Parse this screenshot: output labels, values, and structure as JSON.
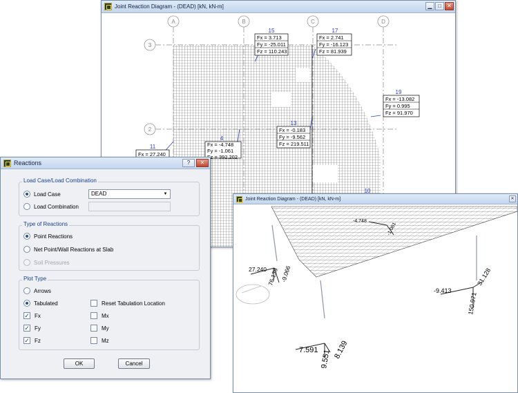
{
  "plan_window": {
    "title": "Joint Reaction Diagram   - (DEAD)  [kN,  kN-m]",
    "grid_columns": [
      "A",
      "B",
      "C",
      "D"
    ],
    "grid_rows": [
      "3",
      "2"
    ],
    "joints": [
      {
        "id": "15",
        "fx": "Fx = 3.713",
        "fy": "Fy = -25.011",
        "fz": "Fz = 110.243"
      },
      {
        "id": "17",
        "fx": "Fx = 2.741",
        "fy": "Fy = -16.123",
        "fz": "Fz = 81.939"
      },
      {
        "id": "19",
        "fx": "Fx = -13.082",
        "fy": "Fy = 0.995",
        "fz": "Fz = 91.970"
      },
      {
        "id": "13",
        "fx": "Fx = -0.183",
        "fy": "Fy = -9.562",
        "fz": "Fz = 219.511"
      },
      {
        "id": "4",
        "fx": "Fx = -4.748",
        "fy": "Fy = -1.061",
        "fz": "Fz = 392.202"
      },
      {
        "id": "11",
        "fx": "Fx = 27.240",
        "fy": "",
        "fz": ""
      },
      {
        "id": "10",
        "fx": "",
        "fy": "",
        "fz": ""
      }
    ]
  },
  "view3d_window": {
    "title": "Joint Reaction Diagram  - (DEAD)  [kN,  kN-m]",
    "labels": {
      "a1": "27.240",
      "a2": "76.139",
      "a3": "-9.066",
      "b1": "-4.748",
      "b2": "-1.061",
      "c1": "-9.413",
      "c2": "150.971",
      "c3": "31.128",
      "d1": "7.591",
      "d2": "8.139",
      "d3": "9.551"
    }
  },
  "dialog": {
    "title": "Reactions",
    "help_btn": "?",
    "close_btn": "✕",
    "load": {
      "group": "Load Case/Load Combination",
      "load_case_label": "Load Case",
      "load_case_value": "DEAD",
      "load_combo_label": "Load Combination"
    },
    "reaction_type": {
      "group": "Type of Reactions",
      "point": "Point Reactions",
      "net": "Net Point/Wall Reactions at Slab",
      "soil": "Soil Pressures"
    },
    "plot_type": {
      "group": "Plot Type",
      "arrows": "Arrows",
      "tabulated": "Tabulated",
      "reset": "Reset Tabulation Location",
      "fx": "Fx",
      "fy": "Fy",
      "fz": "Fz",
      "mx": "Mx",
      "my": "My",
      "mz": "Mz",
      "checked": {
        "fx": true,
        "fy": true,
        "fz": true,
        "mx": false,
        "my": false,
        "mz": false,
        "reset": false
      }
    },
    "ok": "OK",
    "cancel": "Cancel"
  },
  "colors": {
    "title_text": "#102040",
    "group_title": "#1a3f8c",
    "joint_label": "#2a3ccf"
  }
}
